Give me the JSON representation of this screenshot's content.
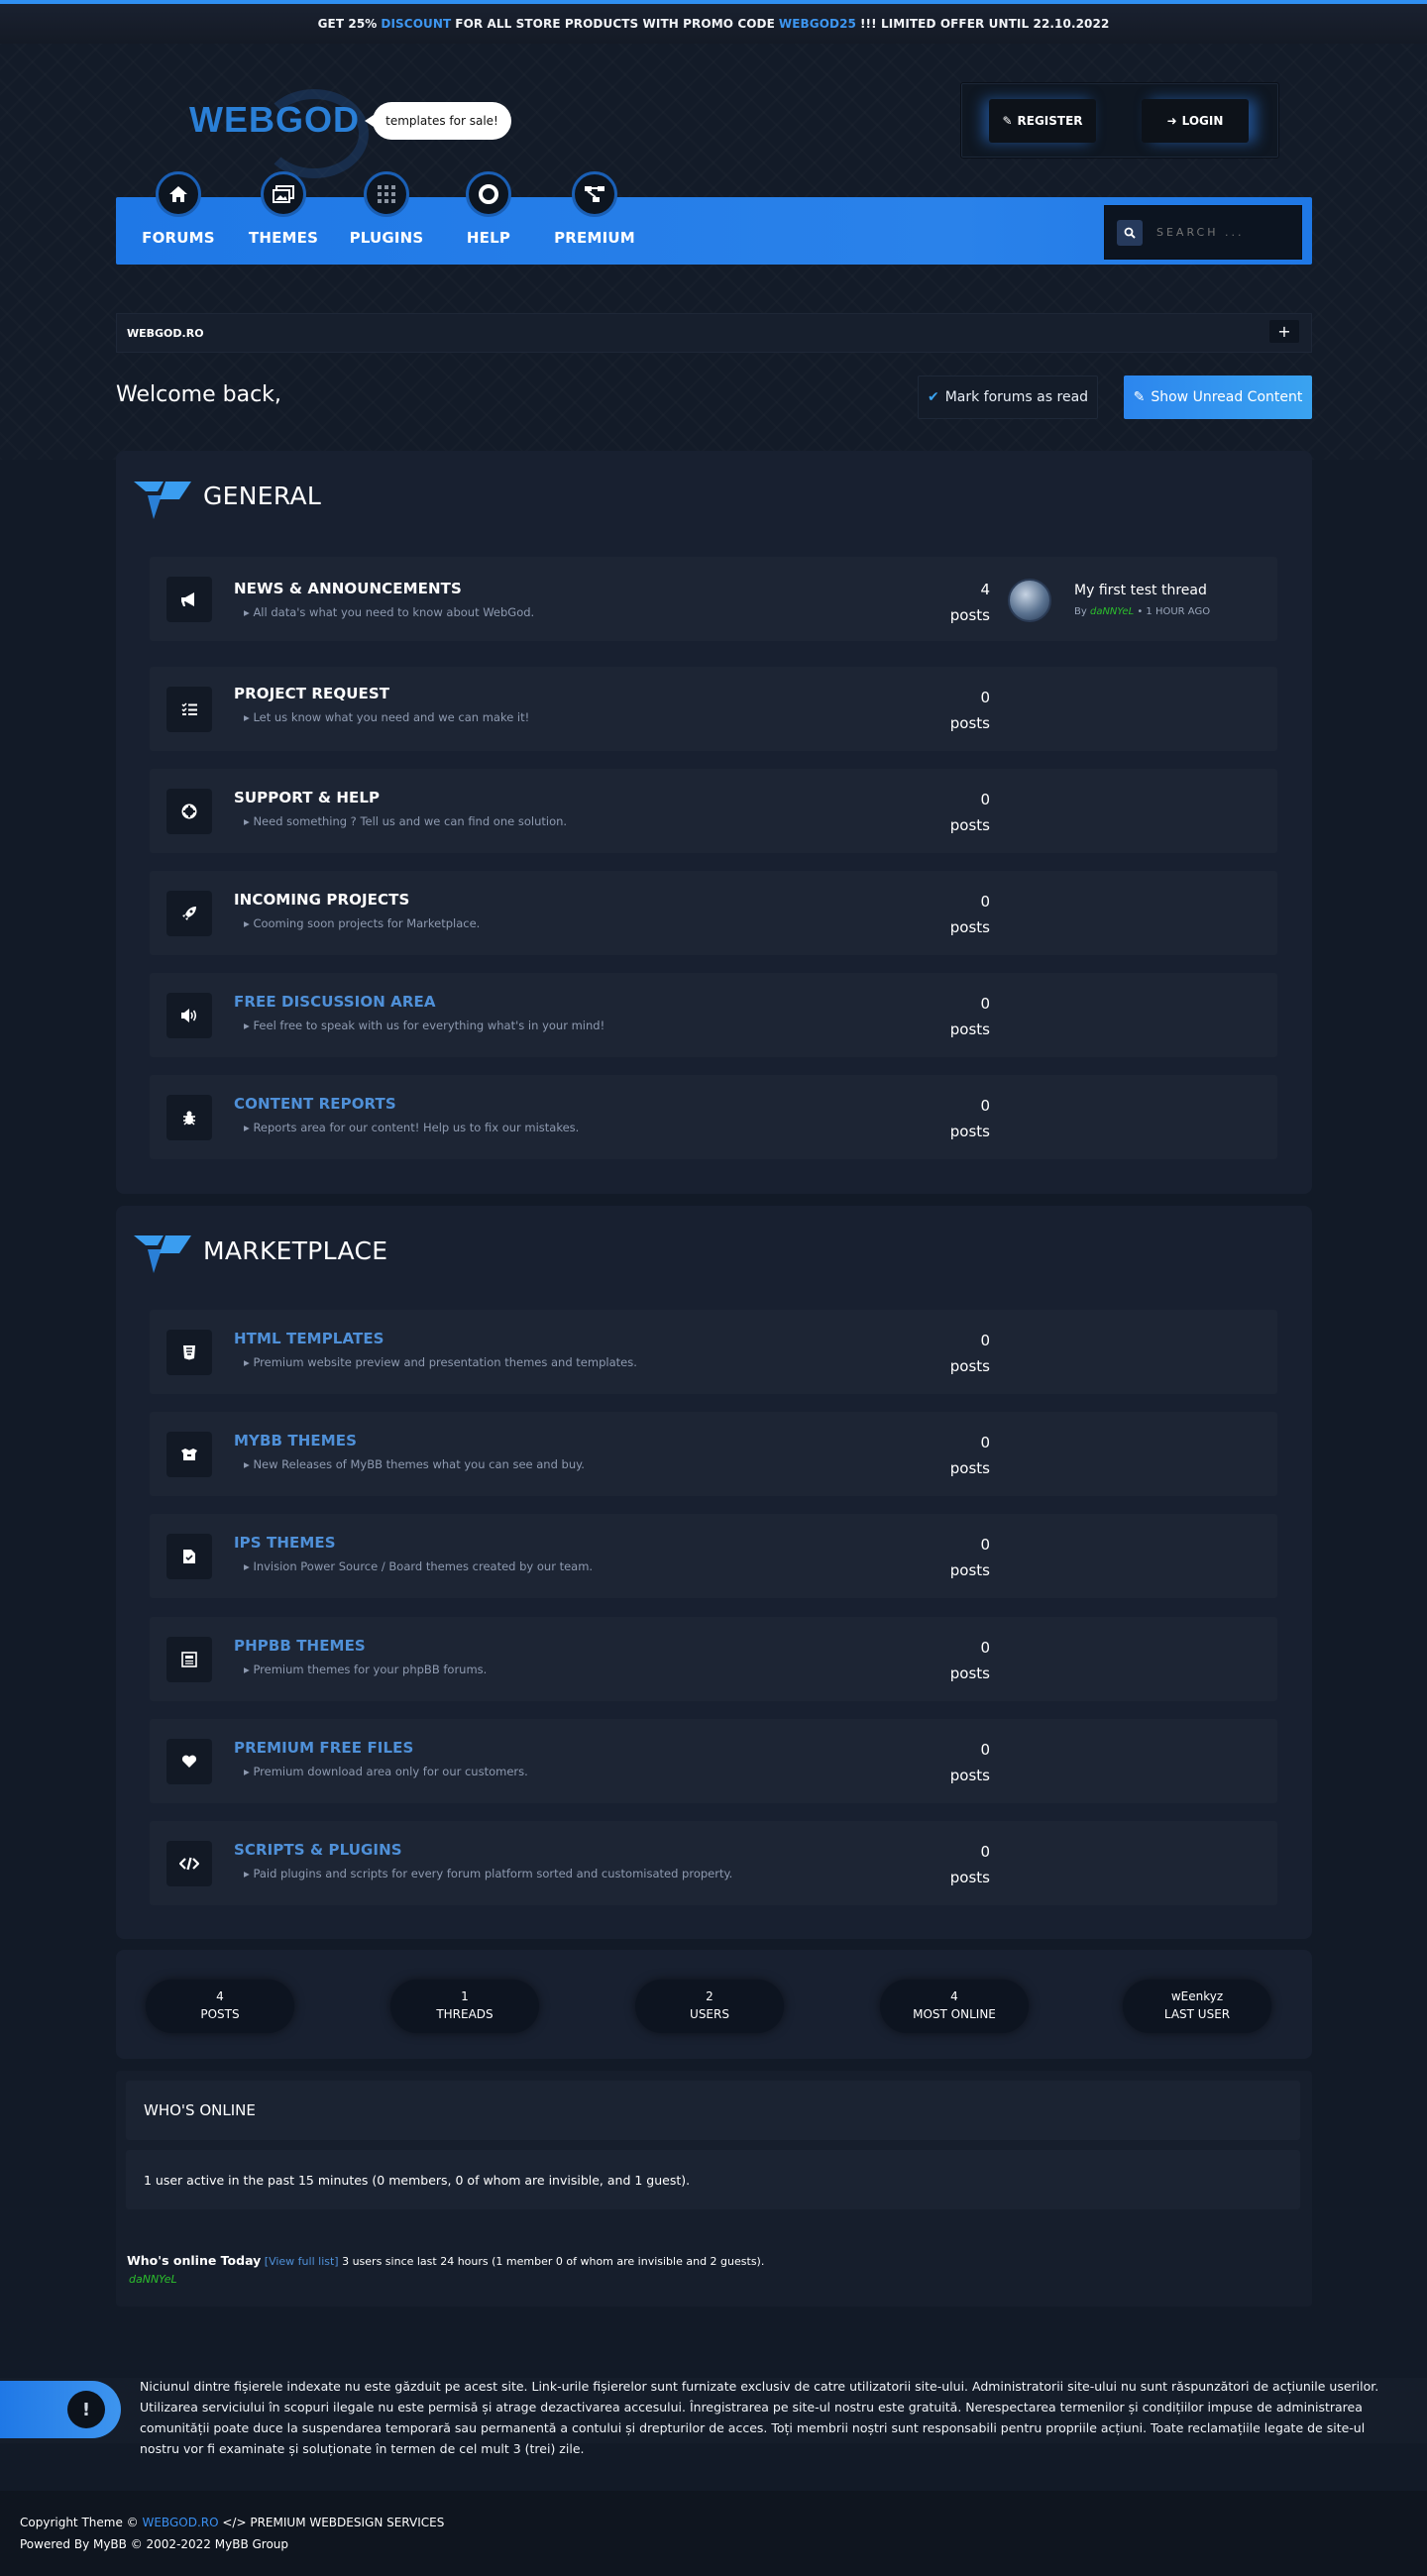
{
  "promo": {
    "prefix": "GET 25%",
    "highlight1": "DISCOUNT",
    "middle": "FOR ALL STORE PRODUCTS WITH PROMO CODE",
    "code": "WEBGOD25",
    "suffix": "!!! LIMITED OFFER UNTIL 22.10.2022"
  },
  "header": {
    "logo": "WEBGOD",
    "bubble": "templates for sale!",
    "register": "REGISTER",
    "login": "LOGIN"
  },
  "nav": {
    "items": [
      {
        "label": "FORUMS",
        "icon": "home-icon"
      },
      {
        "label": "THEMES",
        "icon": "images-icon"
      },
      {
        "label": "PLUGINS",
        "icon": "grid-icon"
      },
      {
        "label": "HELP",
        "icon": "lifebuoy-icon"
      },
      {
        "label": "PREMIUM",
        "icon": "sitemap-icon"
      }
    ],
    "search_placeholder": "SEARCH ..."
  },
  "breadcrumb": "WEBGOD.RO",
  "welcome": "Welcome back,",
  "buttons": {
    "mark_read": "Mark forums as read",
    "show_unread": "Show Unread Content"
  },
  "categories": [
    {
      "title": "GENERAL",
      "forums": [
        {
          "title": "NEWS & ANNOUNCEMENTS",
          "desc": "All data's what you need to know about WebGod.",
          "count": "4",
          "unit": "posts",
          "icon": "megaphone-icon",
          "highlight": false
        },
        {
          "title": "PROJECT REQUEST",
          "desc": "Let us know what you need and we can make it!",
          "count": "0",
          "unit": "posts",
          "icon": "tasks-icon",
          "highlight": false
        },
        {
          "title": "SUPPORT & HELP",
          "desc": "Need something ? Tell us and we can find one solution.",
          "count": "0",
          "unit": "posts",
          "icon": "support-icon",
          "highlight": false
        },
        {
          "title": "INCOMING PROJECTS",
          "desc": "Cooming soon projects for Marketplace.",
          "count": "0",
          "unit": "posts",
          "icon": "rocket-icon",
          "highlight": false
        },
        {
          "title": "FREE DISCUSSION AREA",
          "desc": "Feel free to speak with us for everything what's in your mind!",
          "count": "0",
          "unit": "posts",
          "icon": "speaker-icon",
          "highlight": true
        },
        {
          "title": "CONTENT REPORTS",
          "desc": "Reports area for our content! Help us to fix our mistakes.",
          "count": "0",
          "unit": "posts",
          "icon": "bug-icon",
          "highlight": true
        }
      ]
    },
    {
      "title": "MARKETPLACE",
      "forums": [
        {
          "title": "HTML TEMPLATES",
          "desc": "Premium website preview and presentation themes and templates.",
          "count": "0",
          "unit": "posts",
          "icon": "html5-icon",
          "highlight": true
        },
        {
          "title": "MYBB THEMES",
          "desc": "New Releases of MyBB themes what you can see and buy.",
          "count": "0",
          "unit": "posts",
          "icon": "box-icon",
          "highlight": true
        },
        {
          "title": "IPS THEMES",
          "desc": "Invision Power Source / Board themes created by our team.",
          "count": "0",
          "unit": "posts",
          "icon": "file-icon",
          "highlight": true
        },
        {
          "title": "PHPBB THEMES",
          "desc": "Premium themes for your phpBB forums.",
          "count": "0",
          "unit": "posts",
          "icon": "newspaper-icon",
          "highlight": true
        },
        {
          "title": "PREMIUM FREE FILES",
          "desc": "Premium download area only for our customers.",
          "count": "0",
          "unit": "posts",
          "icon": "heart-icon",
          "highlight": true
        },
        {
          "title": "SCRIPTS & PLUGINS",
          "desc": "Paid plugins and scripts for every forum platform sorted and customisated property.",
          "count": "0",
          "unit": "posts",
          "icon": "code-icon",
          "highlight": true
        }
      ]
    }
  ],
  "last_post": {
    "title": "My first test thread",
    "by": "By",
    "user": "daNNYeL",
    "time": "• 1 HOUR AGO"
  },
  "stats": [
    {
      "value": "4",
      "label": "POSTS"
    },
    {
      "value": "1",
      "label": "THREADS"
    },
    {
      "value": "2",
      "label": "USERS"
    },
    {
      "value": "4",
      "label": "MOST ONLINE"
    },
    {
      "value": "wEenkyz",
      "label": "LAST USER"
    }
  ],
  "whos_online": {
    "title": "WHO'S ONLINE",
    "active": "1 user active in the past 15 minutes (0 members, 0 of whom are invisible, and 1 guest).",
    "today_label": "Who's online Today",
    "view_full_pre": "[",
    "view_full": "View full list",
    "view_full_post": "]",
    "today_text": "3 users since last 24 hours (1 member 0 of whom are invisible and 2 guests).",
    "today_user": "daNNYeL"
  },
  "disclaimer": "Niciunul dintre fișierele indexate nu este găzduit pe acest site. Link-urile fișierelor sunt furnizate exclusiv de catre utilizatorii site-ului. Administratorii site-ului nu sunt răspunzători de acțiunile userilor. Utilizarea serviciului în scopuri ilegale nu este permisă și atrage dezactivarea accesului. Înregistrarea pe site-ul nostru este gratuită. Nerespectarea termenilor și condițiilor impuse de administrarea comunității poate duce la suspendarea temporară sau permanentă a contului și drepturilor de acces. Toți membrii noștri sunt responsabili pentru propriile acțiuni. Toate reclamațiile legate de site-ul nostru vor fi examinate și soluționate în termen de cel mult 3 (trei) zile.",
  "footer": {
    "copy": "Copyright Theme ©",
    "site": "WEBGOD.RO",
    "services": "PREMIUM WEBDESIGN SERVICES",
    "powered": "Powered By MyBB © 2002-2022 MyBB Group"
  },
  "colors": {
    "accent": "#2f8ff2",
    "link": "#4f90d8",
    "online_user": "#2cbf2c",
    "background": "#121a27"
  }
}
